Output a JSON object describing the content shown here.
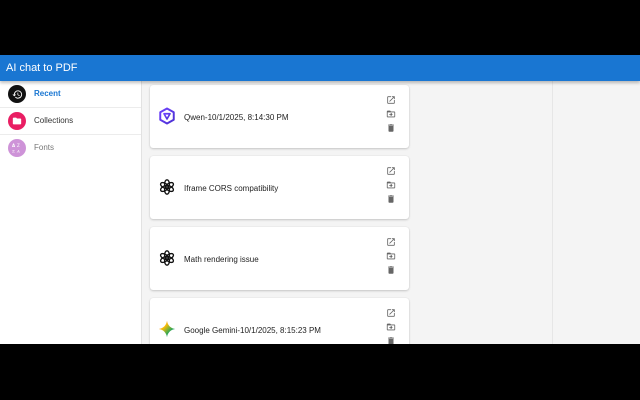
{
  "app": {
    "title": "AI chat to PDF"
  },
  "sidebar": {
    "items": [
      {
        "label": "Recent",
        "icon": "history-icon",
        "color": "#111111",
        "active": true
      },
      {
        "label": "Collections",
        "icon": "folder-icon",
        "color": "#e91e63",
        "active": false
      },
      {
        "label": "Fonts",
        "icon": "fonts-icon",
        "color": "#ce93d8",
        "active": false
      }
    ]
  },
  "chats": [
    {
      "title": "Qwen-10/1/2025, 8:14:30 PM",
      "logo": "qwen-logo-icon"
    },
    {
      "title": "Iframe CORS compatibility",
      "logo": "chatgpt-logo-icon"
    },
    {
      "title": "Math rendering issue",
      "logo": "chatgpt-logo-icon"
    },
    {
      "title": "Google Gemini-10/1/2025, 8:15:23 PM",
      "logo": "gemini-logo-icon"
    }
  ],
  "colors": {
    "appbar": "#1976d2",
    "active_nav": "#1976d2"
  }
}
